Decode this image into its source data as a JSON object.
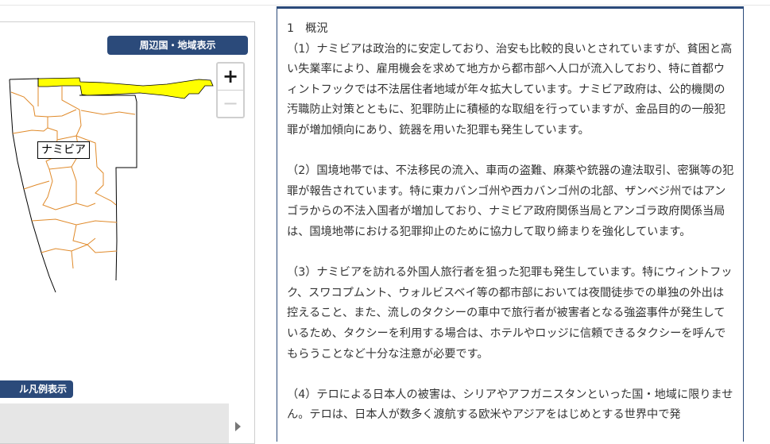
{
  "map": {
    "region_button_label": "周辺国・地域表示",
    "zoom_in_label": "+",
    "zoom_out_label": "−",
    "country_label": "ナミビア",
    "legend_button_label": "ル凡例表示",
    "colors": {
      "highlight_region": "#ffff00",
      "province_border": "#e08a2a",
      "button_bg": "#2b4a7a"
    }
  },
  "article": {
    "heading": "1　概況",
    "paragraphs": [
      "（1）ナミビアは政治的に安定しており、治安も比較的良いとされていますが、貧困と高い失業率により、雇用機会を求めて地方から都市部へ人口が流入しており、特に首都ウィントフックでは不法居住者地域が年々拡大しています。ナミビア政府は、公的機関の汚職防止対策とともに、犯罪防止に積極的な取組を行っていますが、金品目的の一般犯罪が増加傾向にあり、銃器を用いた犯罪も発生しています。",
      "（2）国境地帯では、不法移民の流入、車両の盗難、麻薬や銃器の違法取引、密猟等の犯罪が報告されています。特に東カバンゴ州や西カバンゴ州の北部、ザンベジ州ではアンゴラからの不法入国者が増加しており、ナミビア政府関係当局とアンゴラ政府関係当局は、国境地帯における犯罪抑止のために協力して取り締まりを強化しています。",
      "（3）ナミビアを訪れる外国人旅行者を狙った犯罪も発生しています。特にウィントフック、スワコプムント、ウォルビスベイ等の都市部においては夜間徒歩での単独の外出は控えること、また、流しのタクシーの車中で旅行者が被害者となる強盗事件が発生しているため、タクシーを利用する場合は、ホテルやロッジに信頼できるタクシーを呼んでもらうことなど十分な注意が必要です。",
      "（4）テロによる日本人の被害は、シリアやアフガニスタンといった国・地域に限りません。テロは、日本人が数多く渡航する欧米やアジアをはじめとする世界中で発"
    ]
  }
}
